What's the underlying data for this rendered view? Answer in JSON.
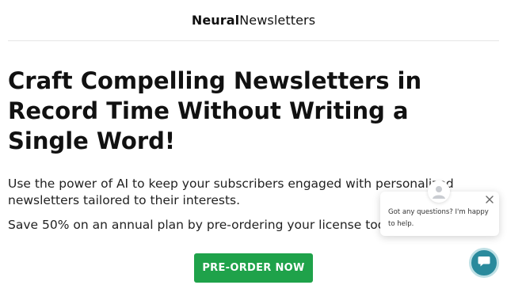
{
  "header": {
    "logo_bold": "Neural",
    "logo_light": "Newsletters"
  },
  "hero": {
    "headline": "Craft Compelling Newsletters in Record Time Without Writing a Single Word!",
    "description": "Use the power of AI to keep your subscribers engaged with personalized newsletters tailored to their interests.",
    "offer": "Save 50% on an annual plan by pre-ordering your license today",
    "cta_label": "PRE-ORDER NOW"
  },
  "chat": {
    "message": "Got any questions? I'm happy to help.",
    "close_icon": "close-icon",
    "avatar_icon": "user-avatar-icon",
    "launcher_icon": "chat-bubble-icon"
  },
  "colors": {
    "cta": "#1fa24a",
    "launcher": "#2a8a9c"
  }
}
